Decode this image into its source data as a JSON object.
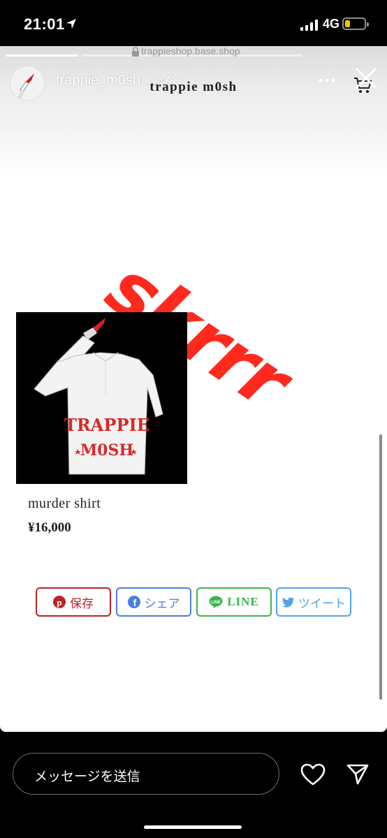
{
  "status_bar": {
    "time": "21:01",
    "network": "4G",
    "battery_level": 0.2
  },
  "story": {
    "url": "trappieshop.base.shop",
    "username": "trappie_m0sh",
    "time_ago": "1分",
    "progress_segments": 4,
    "progress_active": 1
  },
  "shop": {
    "name": "trappie m0sh"
  },
  "sticker": {
    "text": "skrrr"
  },
  "product": {
    "name": "murder shirt",
    "price": "¥16,000",
    "image_text_top": "TRAPPIE",
    "image_text_bottom": "M0SH"
  },
  "share_buttons": [
    {
      "label": "保存",
      "icon": "pinterest-icon"
    },
    {
      "label": "シェア",
      "icon": "facebook-icon"
    },
    {
      "label": "LINE",
      "icon": "line-icon"
    },
    {
      "label": "ツイート",
      "icon": "twitter-icon"
    }
  ],
  "message": {
    "placeholder": "メッセージを送信"
  },
  "colors": {
    "sticker": "#ff2a1d",
    "pinterest": "#bd2126",
    "facebook": "#4a7fe0",
    "line": "#39b54a",
    "twitter": "#52a3e8",
    "battery": "#f2c200"
  }
}
